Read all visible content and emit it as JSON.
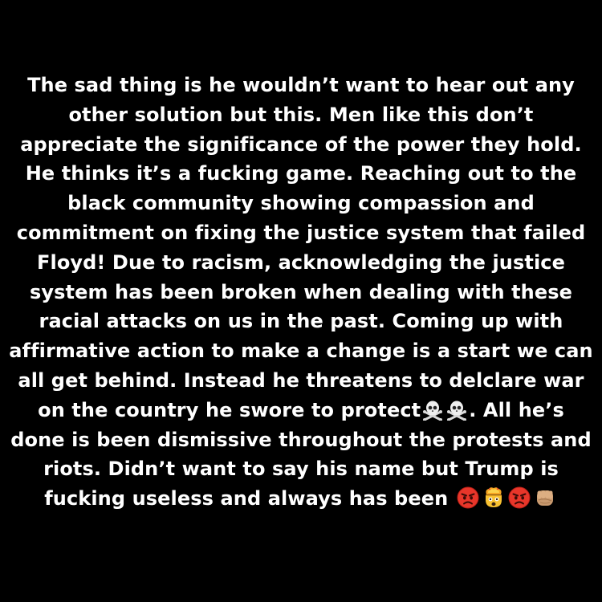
{
  "story": {
    "lines": [
      "The sad thing is he wouldn’t want to hear out any",
      "other solution but this. Men like this don’t",
      "appreciate the significance of the power they hold.",
      "He thinks it’s a fucking game. Reaching out to the",
      "black community showing compassion and",
      "commitment on fixing the justice system that failed",
      "Floyd! Due to racism, acknowledging  the justice",
      "system has been broken when dealing with these",
      "racial attacks on us in the past. Coming up with",
      "affirmative action to make a change is a start we can",
      "all get behind. Instead he threatens  to delclare war",
      "on the country he swore to protect",
      ". All he’s",
      "done is been dismissive throughout the protests and",
      "riots. Didn’t want to say his name but Trump is",
      "fucking useless and always has been"
    ]
  },
  "emojis": {
    "line12": [
      "skull-crossbones-icon",
      "skull-crossbones-icon"
    ],
    "line16": [
      "pouting-face-icon",
      "exploding-head-icon",
      "pouting-face-icon",
      "fist-icon"
    ]
  },
  "colors": {
    "background": "#000000",
    "text": "#ffffff"
  }
}
